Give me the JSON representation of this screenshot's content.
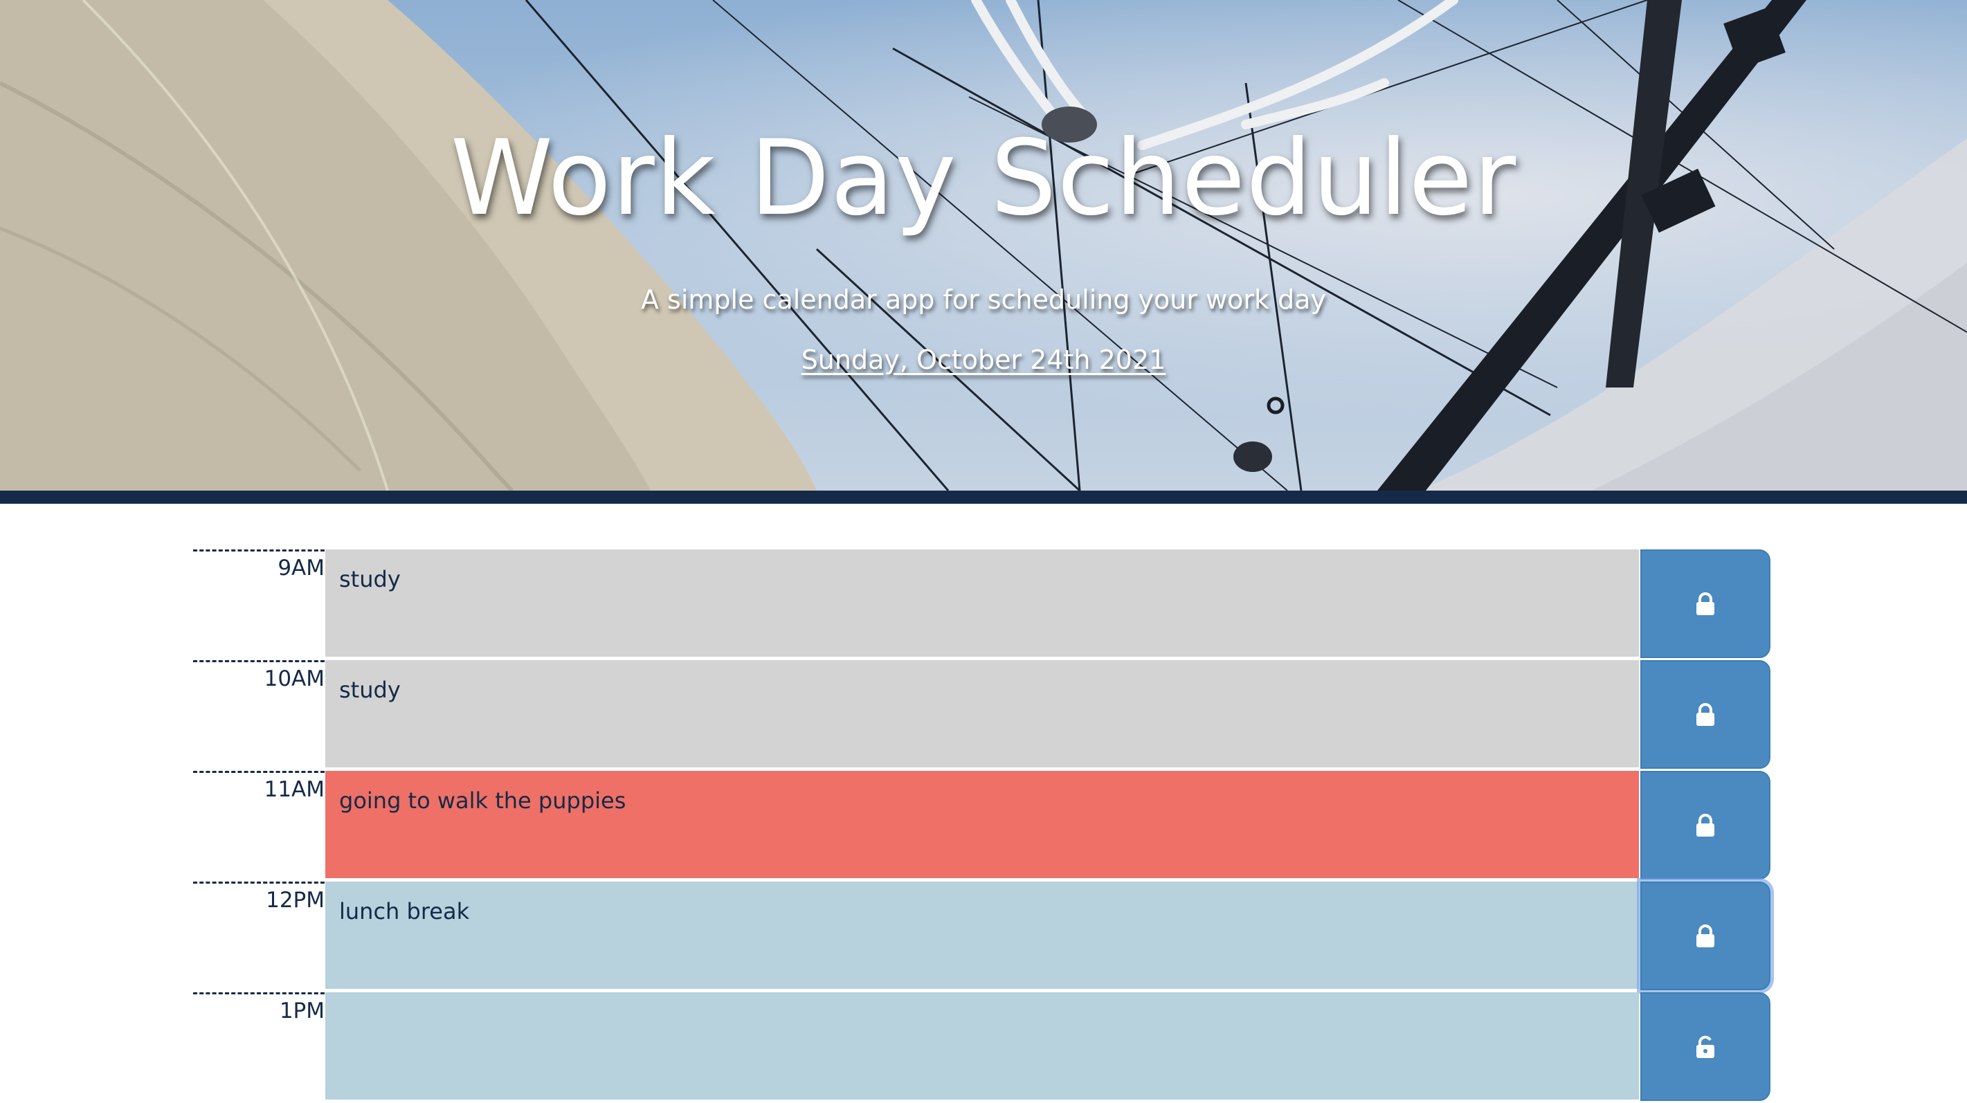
{
  "header": {
    "title": "Work Day Scheduler",
    "subtitle": "A simple calendar app for scheduling your work day",
    "current_date": "Sunday, October 24th 2021"
  },
  "colors": {
    "past": "#d3d3d3",
    "present": "#ee7066",
    "future": "#b7d1dd",
    "save_button": "#4a8ac0",
    "accent_bar": "#152a48"
  },
  "schedule": {
    "rows": [
      {
        "hour": "9AM",
        "text": "study",
        "state": "past",
        "icon": "lock-icon"
      },
      {
        "hour": "10AM",
        "text": "study",
        "state": "past",
        "icon": "lock-icon"
      },
      {
        "hour": "11AM",
        "text": "going to walk the puppies",
        "state": "present",
        "icon": "lock-icon"
      },
      {
        "hour": "12PM",
        "text": "lunch break",
        "state": "future",
        "icon": "lock-icon"
      },
      {
        "hour": "1PM",
        "text": "",
        "state": "future",
        "icon": "unlock-icon"
      }
    ]
  }
}
